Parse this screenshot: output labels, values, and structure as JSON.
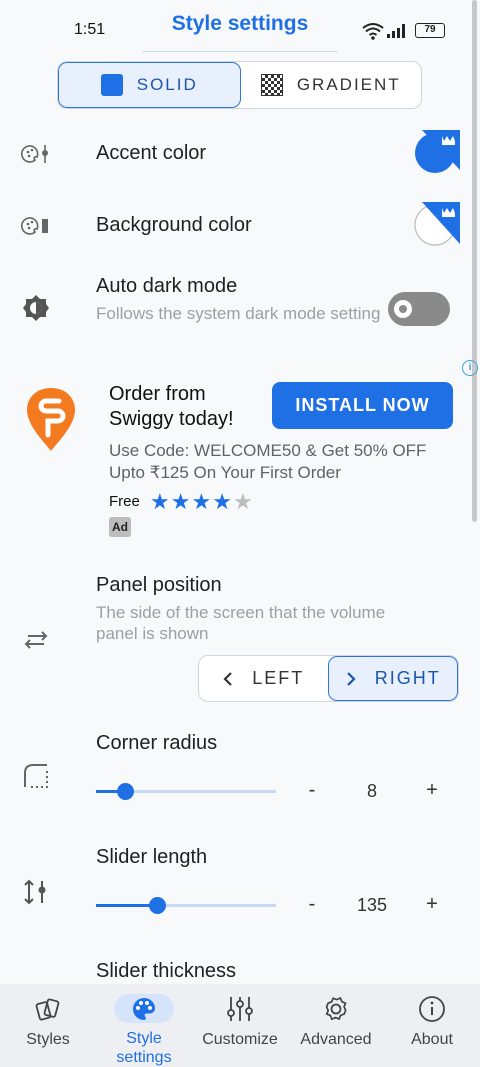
{
  "status_bar": {
    "time": "1:51",
    "battery": "79"
  },
  "screen": {
    "title": "Style settings"
  },
  "style_mode": {
    "options": [
      {
        "label": "SOLID",
        "selected": true
      },
      {
        "label": "GRADIENT",
        "selected": false
      }
    ]
  },
  "rows": {
    "accent": {
      "label": "Accent color",
      "icon": "palette-slider-icon"
    },
    "background": {
      "label": "Background color",
      "icon": "palette-slider-icon"
    },
    "dark_mode": {
      "label": "Auto dark mode",
      "sub": "Follows the system dark mode setting",
      "enabled": false,
      "icon": "brightness-icon"
    }
  },
  "ad": {
    "headline": "Order from Swiggy today!",
    "button": "INSTALL NOW",
    "body": "Use Code: WELCOME50 & Get 50% OFF Upto ₹125 On Your First Order",
    "price": "Free",
    "rating": 4,
    "rating_max": 5,
    "badge": "Ad"
  },
  "panel_position": {
    "label": "Panel position",
    "sub": "The side of the screen that the volume panel is shown",
    "options": [
      {
        "label": "LEFT",
        "selected": false
      },
      {
        "label": "RIGHT",
        "selected": true
      }
    ]
  },
  "corner_radius": {
    "label": "Corner radius",
    "value": "8",
    "minus": "-",
    "plus": "+",
    "fraction": 0.16
  },
  "slider_length": {
    "label": "Slider length",
    "value": "135",
    "minus": "-",
    "plus": "+",
    "fraction": 0.34
  },
  "slider_thickness": {
    "label": "Slider thickness"
  },
  "bottom_nav": [
    {
      "label": "Styles",
      "icon": "cards-icon",
      "active": false
    },
    {
      "label": "Style settings",
      "icon": "palette-icon",
      "active": true
    },
    {
      "label": "Customize",
      "icon": "equalizer-icon",
      "active": false
    },
    {
      "label": "Advanced",
      "icon": "gear-icon",
      "active": false
    },
    {
      "label": "About",
      "icon": "info-icon",
      "active": false
    }
  ],
  "colors": {
    "accent": "#1f6fe5",
    "muted": "#9aa0a6",
    "nav_bg": "#eeeff3"
  }
}
